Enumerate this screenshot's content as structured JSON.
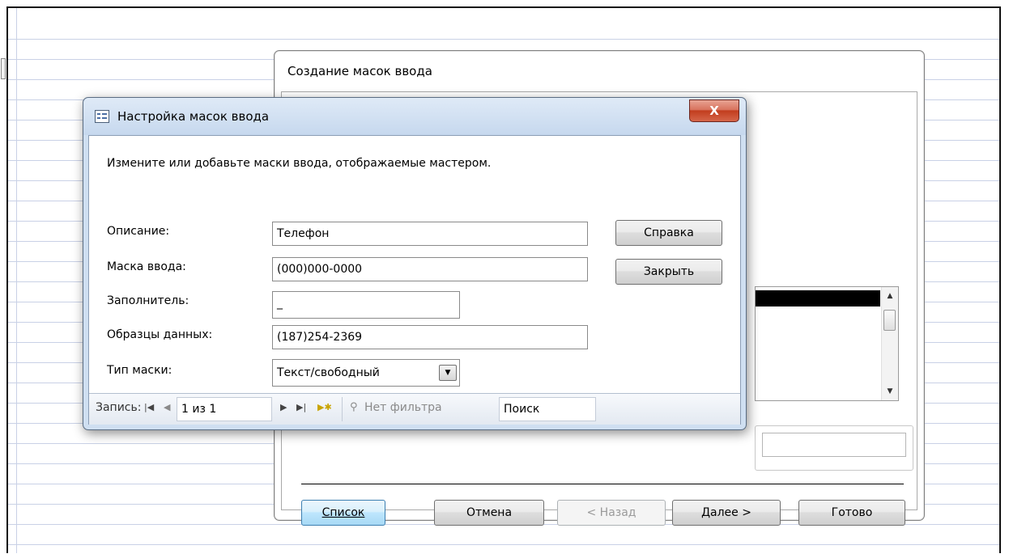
{
  "wizard": {
    "title": "Создание масок ввода",
    "buttons": {
      "list": "Список",
      "cancel": "Отмена",
      "back": "< Назад",
      "next": "Далее >",
      "finish": "Готово"
    }
  },
  "dialog": {
    "title": "Настройка масок ввода",
    "close_symbol": "X",
    "instruction": "Измените или добавьте маски ввода, отображаемые мастером.",
    "fields": {
      "description_label": "Описание:",
      "description_value": "Телефон",
      "mask_label": "Маска ввода:",
      "mask_value": "(000)000-0000",
      "placeholder_label": "Заполнитель:",
      "placeholder_value": "_",
      "sample_label": "Образцы данных:",
      "sample_value": "(187)254-2369",
      "type_label": "Тип маски:",
      "type_value": "Текст/свободный"
    },
    "buttons": {
      "help": "Справка",
      "close": "Закрыть"
    },
    "record_nav": {
      "label": "Запись:",
      "position": "1 из 1",
      "filter": "Нет фильтра",
      "search": "Поиск"
    }
  },
  "icons": [
    "form-icon",
    "first-record-icon",
    "prev-record-icon",
    "next-record-icon",
    "last-record-icon",
    "new-record-icon",
    "filter-icon",
    "dropdown-arrow-icon",
    "scroll-up-icon",
    "scroll-down-icon"
  ]
}
